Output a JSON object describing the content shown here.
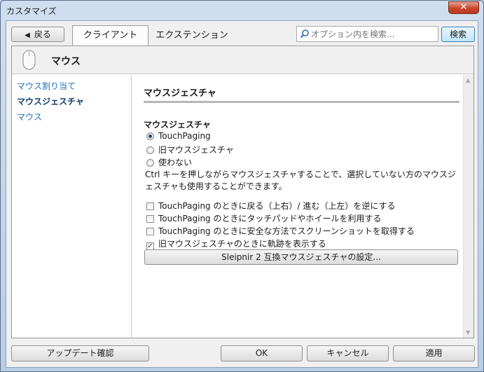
{
  "window": {
    "title": "カスタマイズ",
    "close_glyph": "✕"
  },
  "toolbar": {
    "back_label": "戻る",
    "tabs": [
      {
        "label": "クライアント"
      },
      {
        "label": "エクステンション"
      }
    ],
    "search": {
      "placeholder": "オプション内を検索...",
      "button_label": "検索"
    }
  },
  "header": {
    "title": "マウス",
    "icon": "mouse-icon"
  },
  "sidebar": {
    "items": [
      {
        "label": "マウス割り当て"
      },
      {
        "label": "マウスジェスチャ"
      },
      {
        "label": "マウス"
      }
    ]
  },
  "content": {
    "section_title": "マウスジェスチャ",
    "group_title": "マウスジェスチャ",
    "radios": [
      {
        "label": "TouchPaging",
        "checked": true
      },
      {
        "label": "旧マウスジェスチャ",
        "checked": false
      },
      {
        "label": "使わない",
        "checked": false
      }
    ],
    "description": "Ctrl キーを押しながらマウスジェスチャすることで、選択していない方のマウスジェスチャも使用することができます。",
    "checkboxes": [
      {
        "label": "TouchPaging のときに戻る（上右）/ 進む（上左）を逆にする",
        "checked": false
      },
      {
        "label": "TouchPaging のときにタッチパッドやホイールを利用する",
        "checked": false
      },
      {
        "label": "TouchPaging のときに安全な方法でスクリーンショットを取得する",
        "checked": false
      },
      {
        "label": "旧マウスジェスチャのときに軌跡を表示する",
        "checked": true
      }
    ],
    "settings_button": "Sleipnir 2 互換マウスジェスチャの設定..."
  },
  "footer": {
    "update_label": "アップデート確認",
    "ok_label": "OK",
    "cancel_label": "キャンセル",
    "apply_label": "適用"
  }
}
